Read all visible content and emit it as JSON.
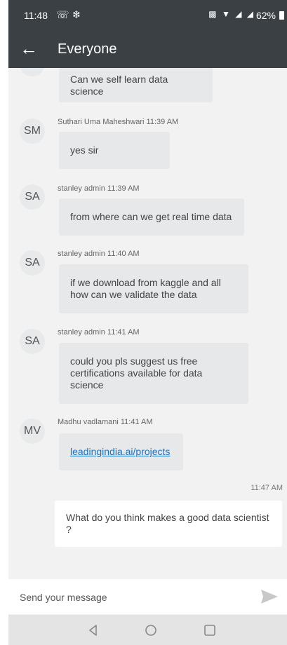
{
  "status_bar": {
    "time": "11:48",
    "left_icons": [
      "whatsapp-icon",
      "snowflake-icon"
    ],
    "battery": "62%",
    "right_icons": [
      "vibrate-icon",
      "wifi-icon",
      "signal-icon"
    ]
  },
  "header": {
    "title": "Everyone",
    "back_icon": "arrow-left-icon"
  },
  "messages": [
    {
      "avatar": "",
      "sender": "",
      "text": "Can we self learn data science"
    },
    {
      "avatar": "SM",
      "sender": "Suthari Uma Maheshwari 11:39 AM",
      "text": "yes sir"
    },
    {
      "avatar": "SA",
      "sender": "stanley admin 11:39 AM",
      "text": "from where can we get real time data"
    },
    {
      "avatar": "SA",
      "sender": "stanley admin 11:40 AM",
      "text": "if we download from kaggle and all how can we validate the data"
    },
    {
      "avatar": "SA",
      "sender": "stanley admin 11:41 AM",
      "text": "could you pls suggest us free certifications available for data science"
    },
    {
      "avatar": "MV",
      "sender": "Madhu vadlamani 11:41 AM",
      "text": "leadingindia.ai/projects",
      "is_link": true
    }
  ],
  "outgoing": {
    "time": "11:47 AM",
    "text": "What do you think  makes a good data scientist ?"
  },
  "composer": {
    "placeholder": "Send your message",
    "send_icon": "send-icon"
  },
  "nav": {
    "icons": [
      "back-triangle-icon",
      "home-circle-icon",
      "recents-square-icon"
    ]
  }
}
